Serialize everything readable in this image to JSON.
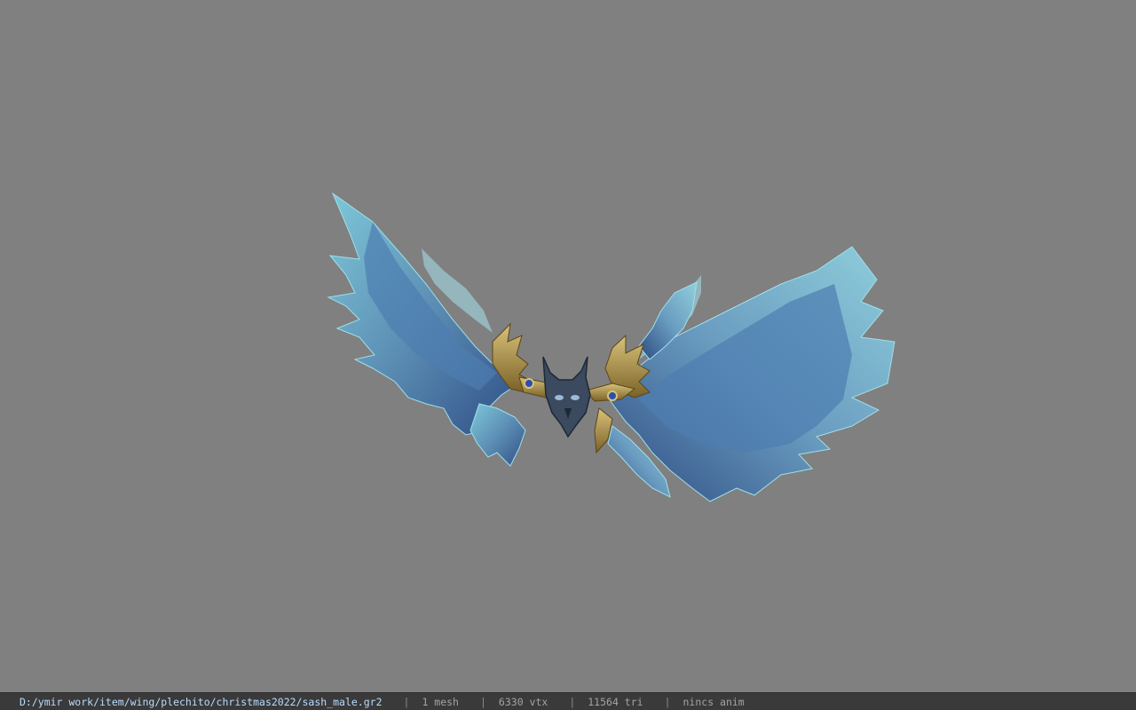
{
  "colors": {
    "background": "#808080",
    "statusbar": "#3a3a3a",
    "path_text": "#b8dcff",
    "stat_text": "#a4a4a4"
  },
  "viewport": {
    "model_icon": "blue-ice-wings-3d-model"
  },
  "statusbar": {
    "path": "D:/ymir work/item/wing/plechito/christmas2022/sash_male.gr2",
    "separator": "|",
    "mesh": "1 mesh",
    "vtx": "6330 vtx",
    "tri": "11564 tri",
    "anim": "nincs anim"
  }
}
